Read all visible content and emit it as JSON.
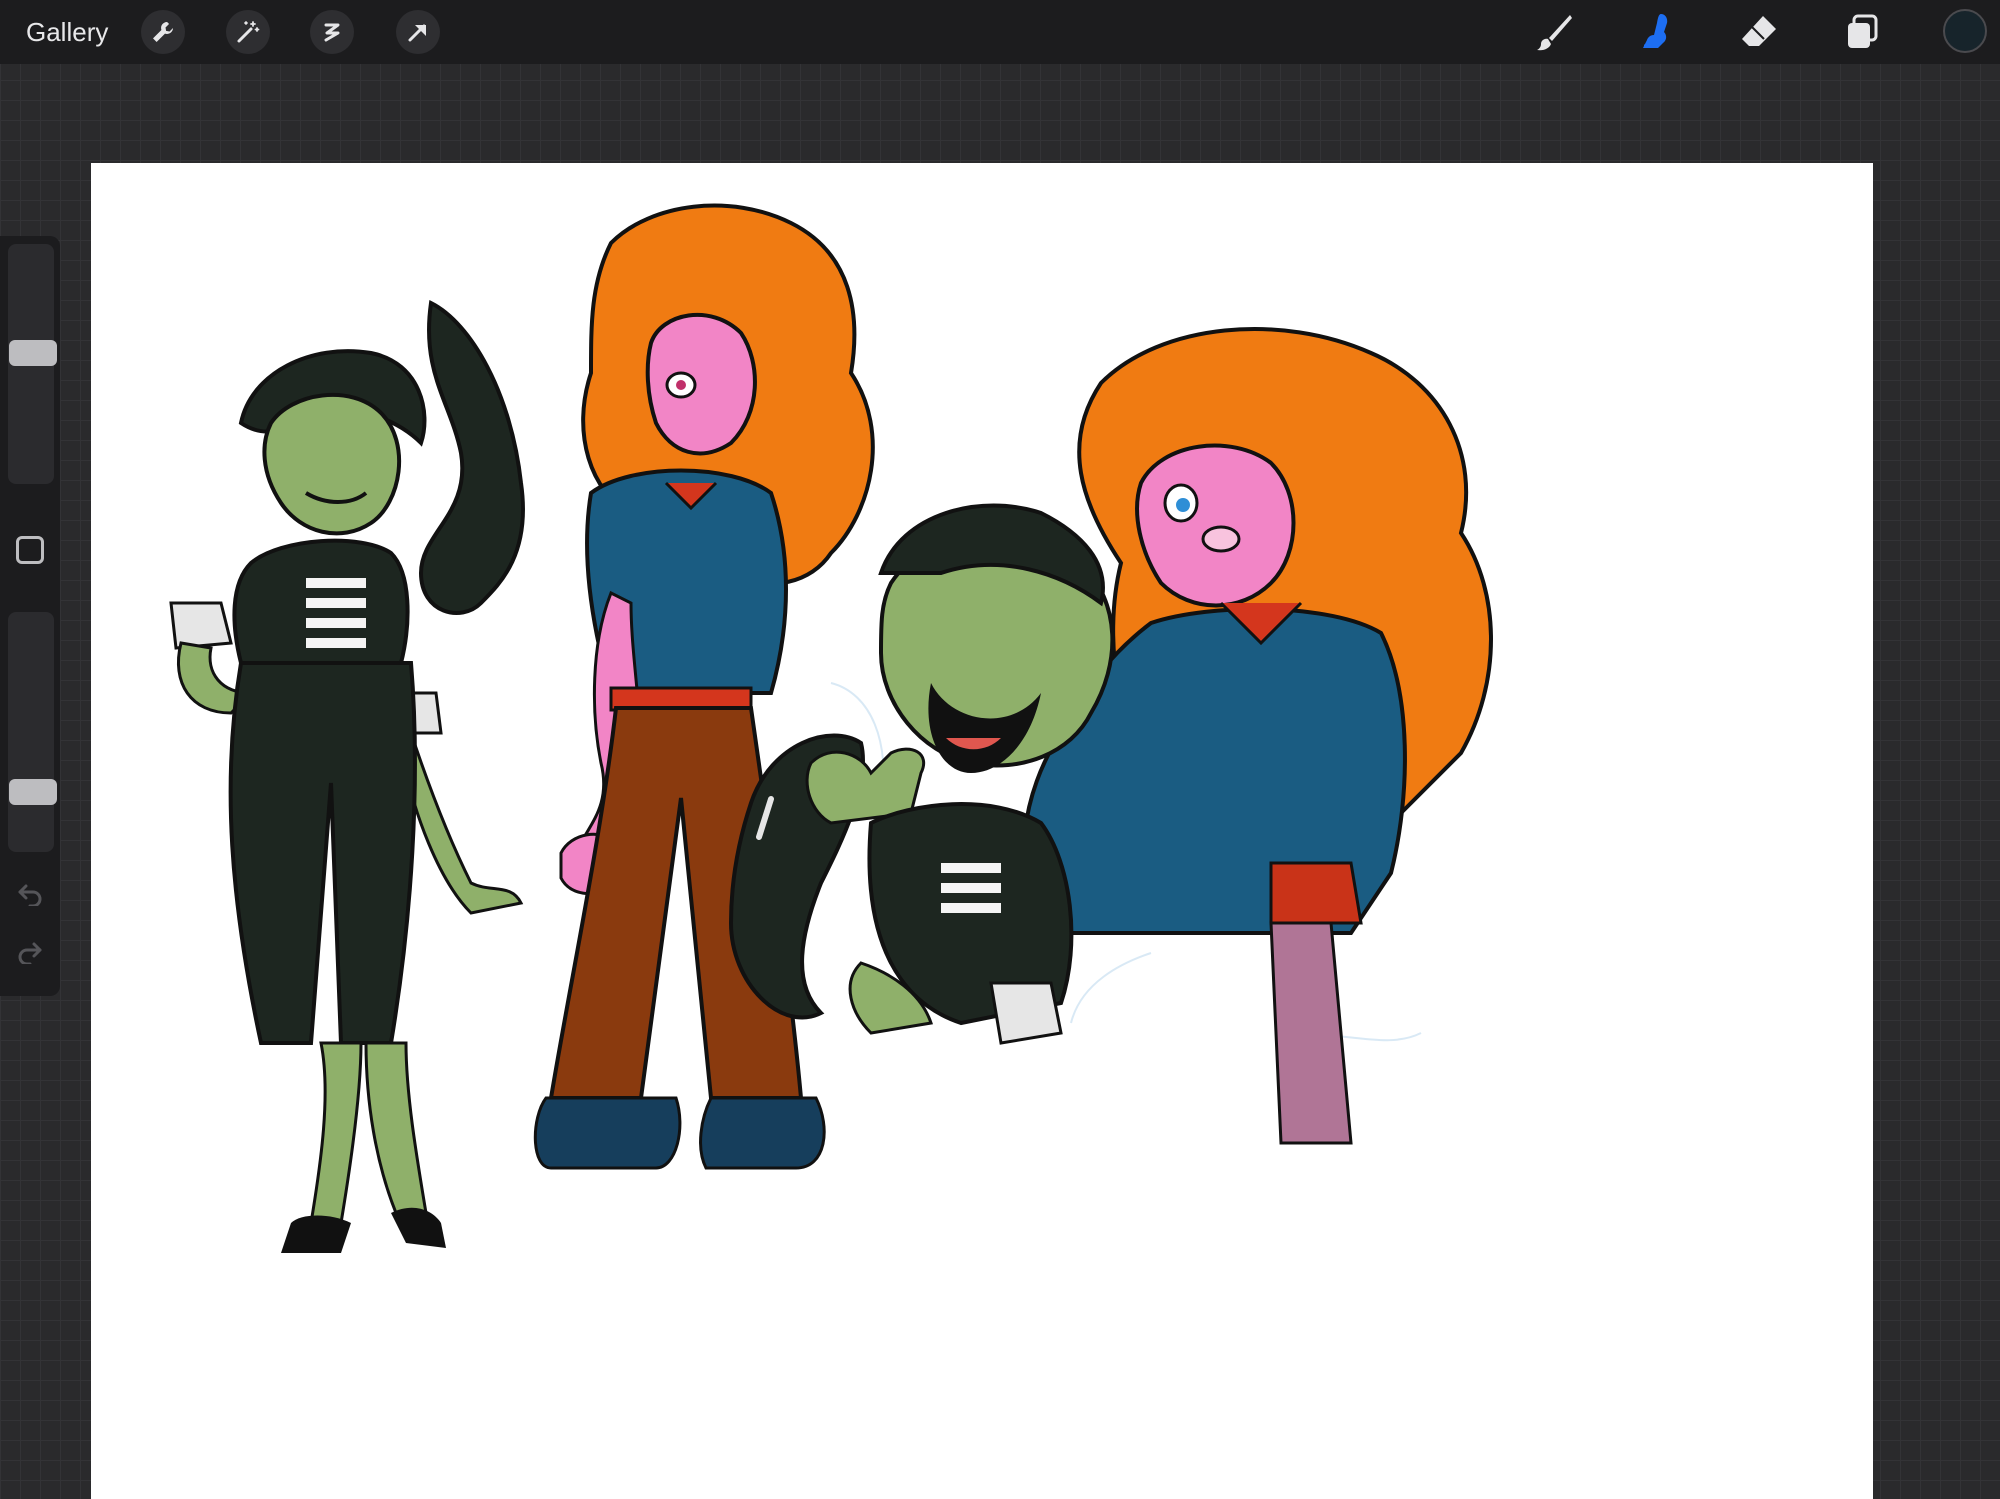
{
  "topbar": {
    "gallery_label": "Gallery",
    "left_tools": [
      "wrench-icon",
      "magic-wand-icon",
      "selection-icon",
      "transform-arrow-icon"
    ],
    "right_tools": [
      "brush-icon",
      "smudge-icon",
      "eraser-icon",
      "layers-icon"
    ],
    "active_tool": "smudge-icon",
    "current_color": "#17242b"
  },
  "sidebar": {
    "brush_size_level": 0.55,
    "opacity_level": 0.22,
    "controls": [
      "modify-button",
      "undo-icon",
      "redo-icon"
    ]
  },
  "colors": {
    "accent_active": "#1d6ef2",
    "icon_default": "#e6e6e8",
    "canvas": "#ffffff"
  }
}
